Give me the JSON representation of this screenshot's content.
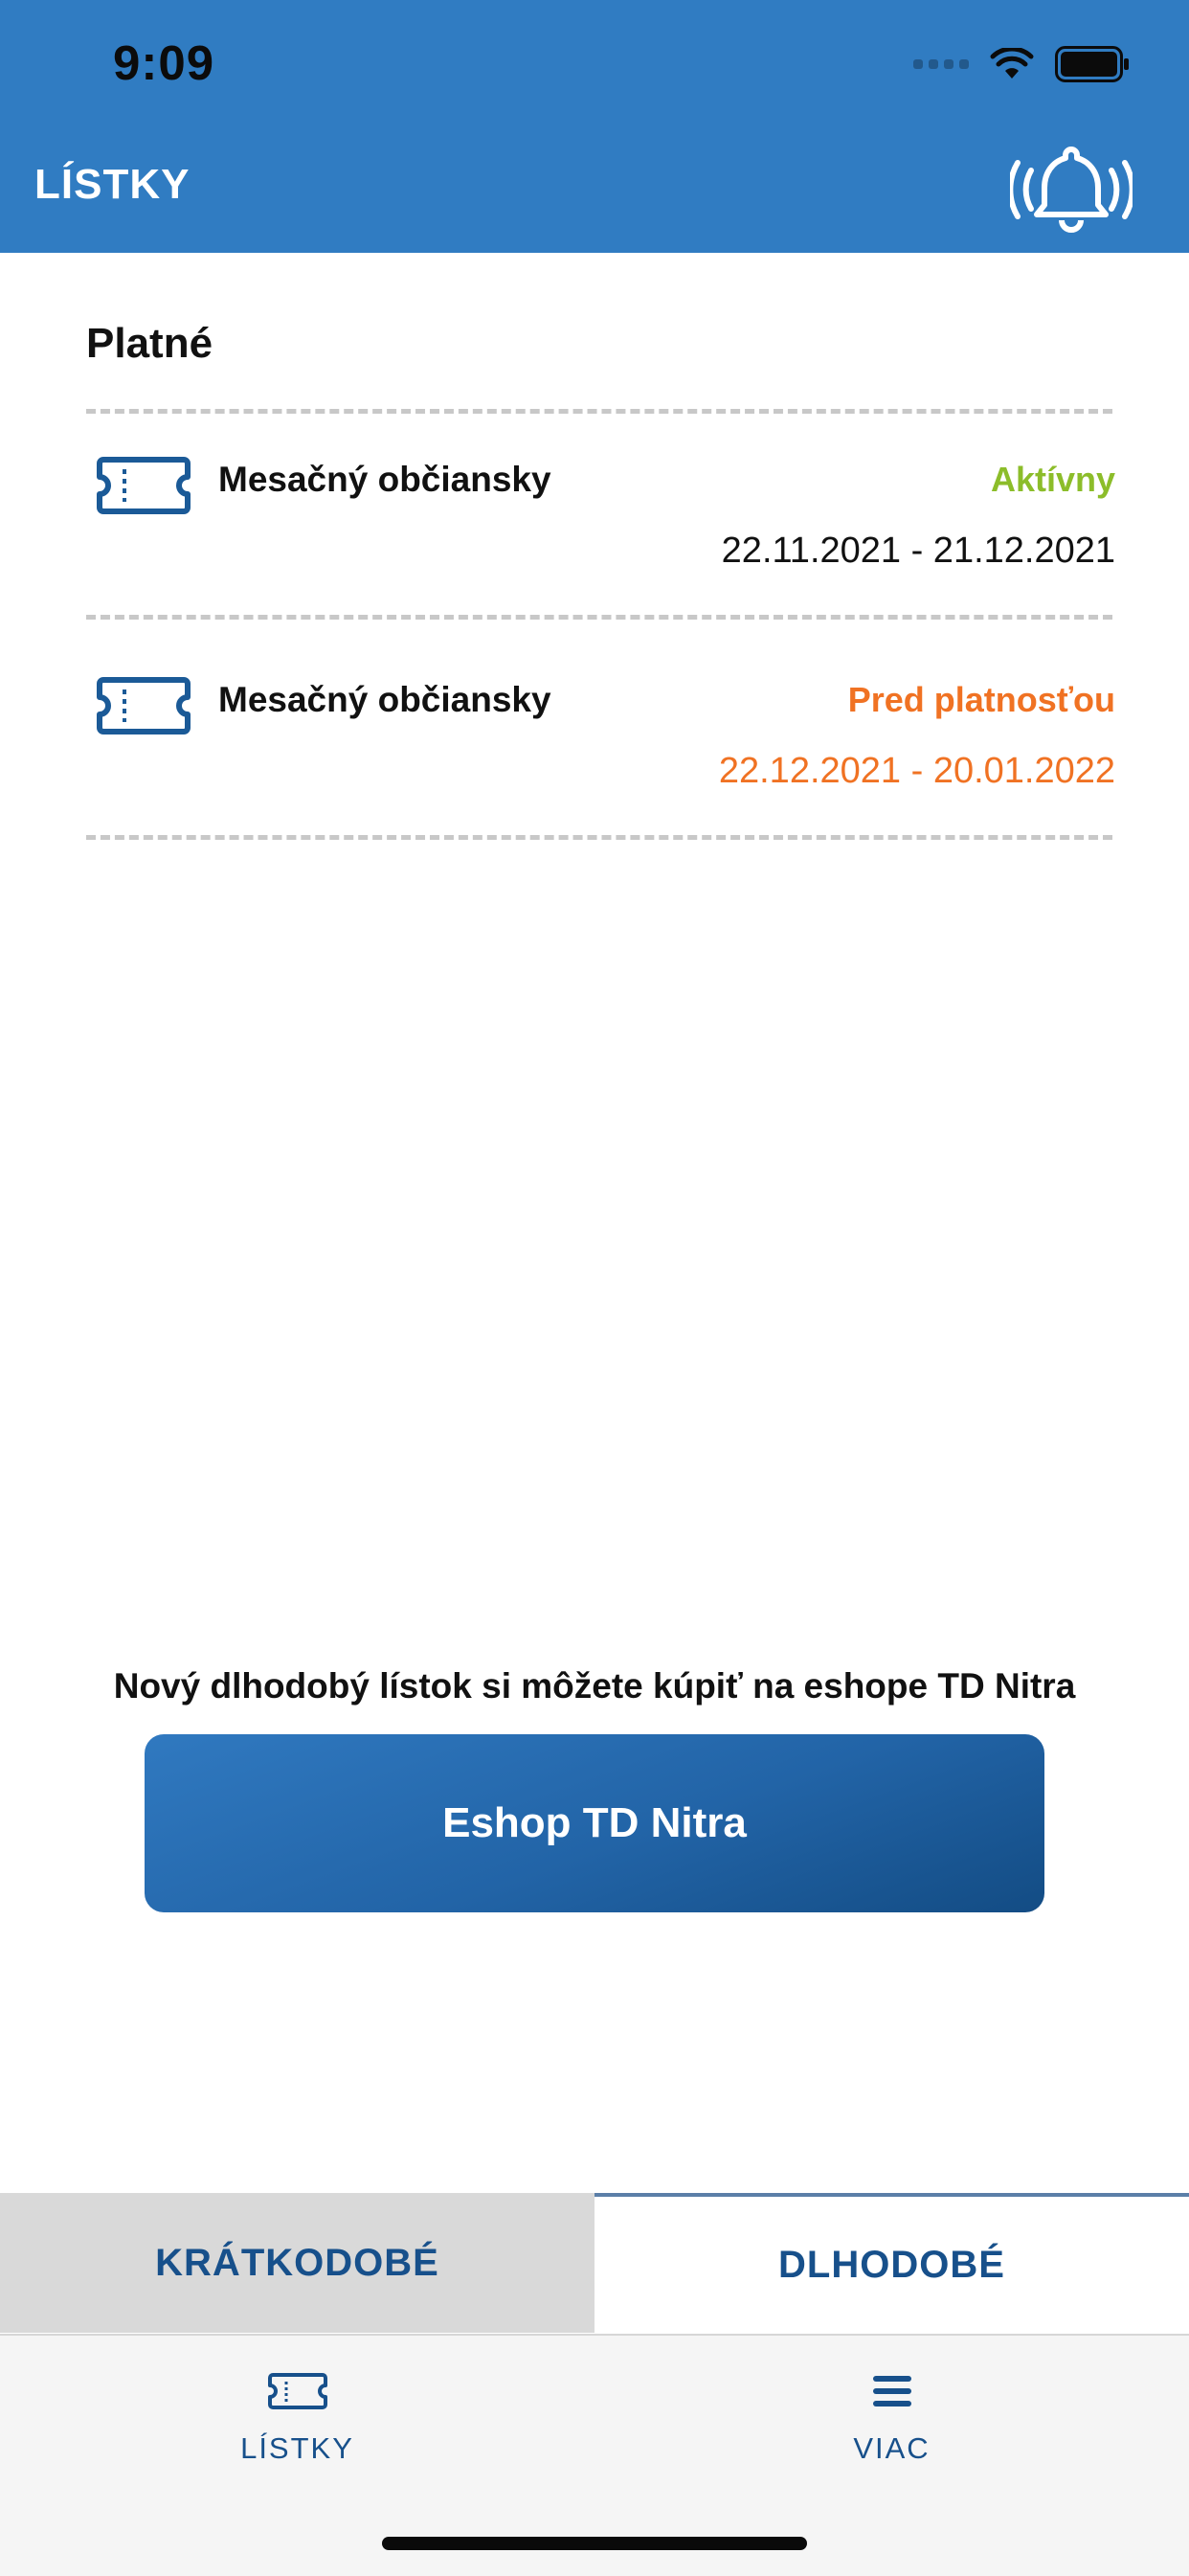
{
  "status_bar": {
    "time": "9:09"
  },
  "header": {
    "title": "LÍSTKY",
    "bell_icon": "bell-ringing-icon"
  },
  "section": {
    "title": "Platné"
  },
  "tickets": [
    {
      "name": "Mesačný občiansky",
      "status": "Aktívny",
      "dates": "22.11.2021 - 21.12.2021",
      "status_color": "#8cbd2a",
      "dates_color": "#111111"
    },
    {
      "name": "Mesačný občiansky",
      "status": "Pred platnosťou",
      "dates": "22.12.2021 - 20.01.2022",
      "status_color": "#f07223",
      "dates_color": "#f07223"
    }
  ],
  "promo": {
    "text": "Nový dlhodobý lístok si môžete kúpiť na eshope TD Nitra",
    "button_label": "Eshop TD Nitra"
  },
  "segments": {
    "short_term": "KRÁTKODOBÉ",
    "long_term": "DLHODOBÉ",
    "selected": "DLHODOBÉ"
  },
  "tab_bar": {
    "items": [
      {
        "label": "LÍSTKY",
        "icon": "ticket-icon"
      },
      {
        "label": "VIAC",
        "icon": "menu-icon"
      }
    ]
  },
  "colors": {
    "brand_blue": "#307cc2",
    "dark_blue": "#17508b",
    "active_green": "#8cbd2a",
    "pending_orange": "#f07223"
  }
}
